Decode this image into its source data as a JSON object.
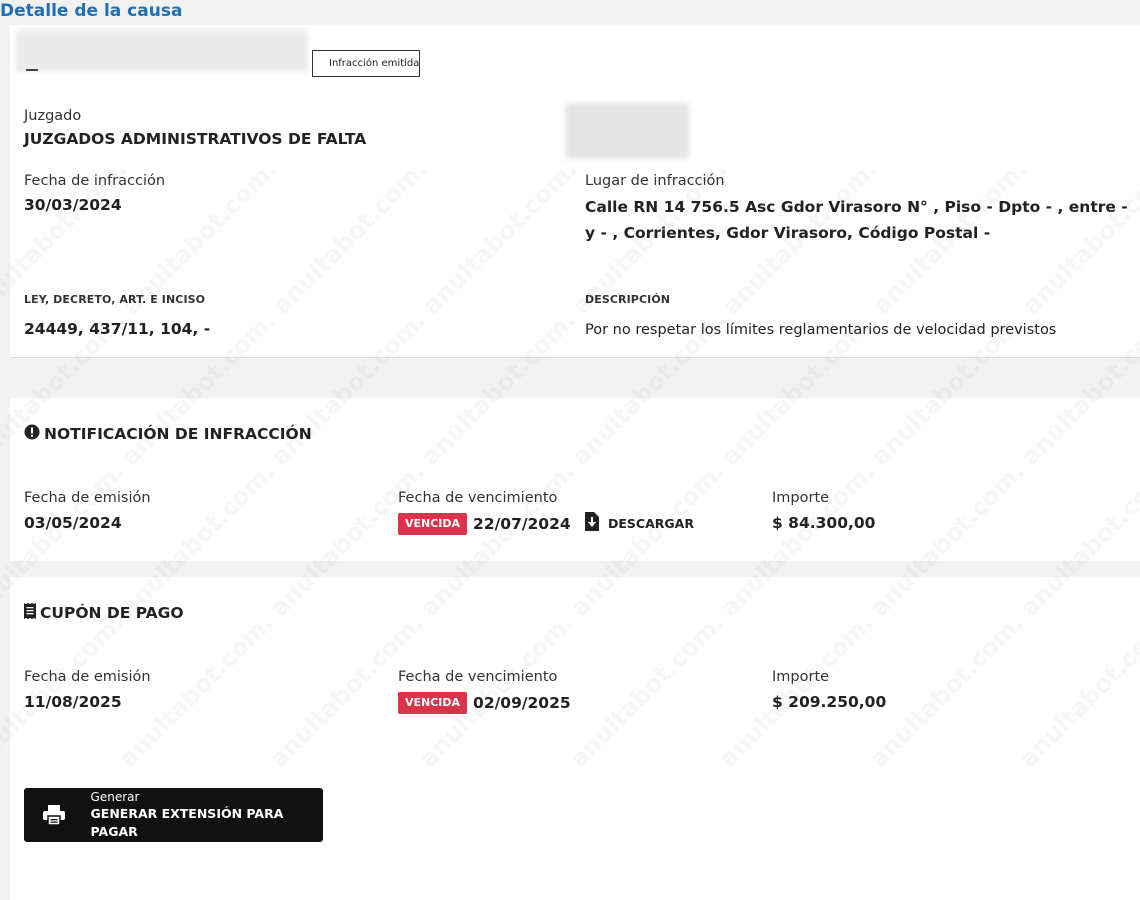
{
  "page": {
    "title": "Detalle de la causa"
  },
  "causa": {
    "status_tag": "Infracción emitida",
    "juzgado_label": "Juzgado",
    "juzgado_value": "JUZGADOS ADMINISTRATIVOS DE FALTA",
    "fecha_infraccion_label": "Fecha de infracción",
    "fecha_infraccion_value": "30/03/2024",
    "lugar_label": "Lugar de infracción",
    "lugar_value": "Calle RN 14 756.5 Asc Gdor Virasoro N° , Piso - Dpto - , entre - y - , Corrientes, Gdor Virasoro, Código Postal -",
    "ley_label": "LEY, DECRETO, ART. E INCISO",
    "ley_value": "24449, 437/11, 104, -",
    "descripcion_label": "DESCRIPCIÓN",
    "descripcion_value": "Por no respetar los límites reglamentarios de velocidad previstos"
  },
  "notificacion": {
    "title": "NOTIFICACIÓN DE INFRACCIÓN",
    "emision_label": "Fecha de emisión",
    "emision_value": "03/05/2024",
    "vencimiento_label": "Fecha de vencimiento",
    "vencida_badge": "VENCIDA",
    "vencimiento_value": "22/07/2024",
    "descargar_label": "DESCARGAR",
    "importe_label": "Importe",
    "importe_value": "$ 84.300,00"
  },
  "cupon": {
    "title": "CUPÓN DE PAGO",
    "emision_label": "Fecha de emisión",
    "emision_value": "11/08/2025",
    "vencimiento_label": "Fecha de vencimiento",
    "vencida_badge": "VENCIDA",
    "vencimiento_value": "02/09/2025",
    "importe_label": "Importe",
    "importe_value": "$ 209.250,00",
    "button_small": "Generar",
    "button_main": "GENERAR EXTENSIÓN PARA PAGAR"
  },
  "watermark": {
    "text": "anultabot.com."
  },
  "colors": {
    "title_blue": "#1f6fb2",
    "badge_red": "#d9344a",
    "button_black": "#111111",
    "page_bg": "#f2f2f2"
  }
}
